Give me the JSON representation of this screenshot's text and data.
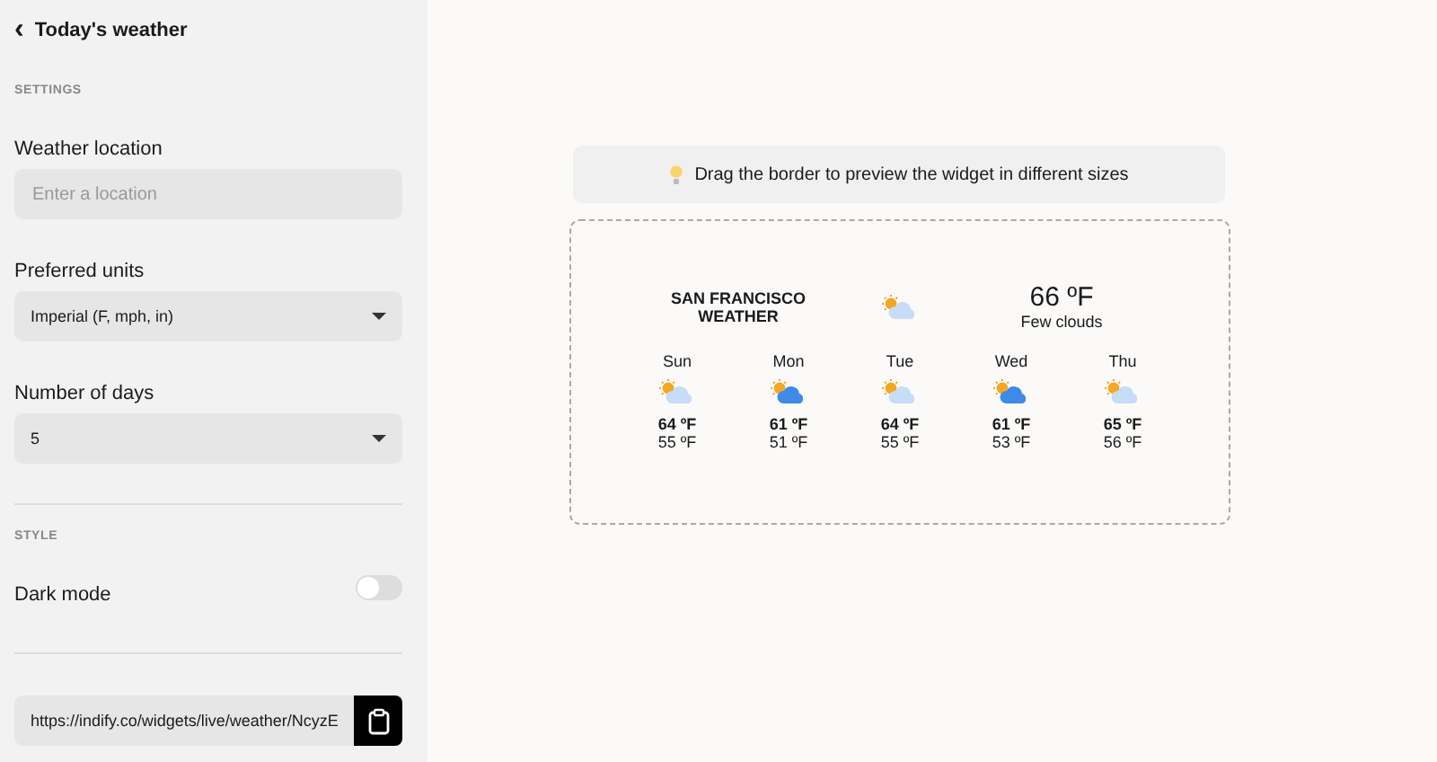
{
  "header": {
    "back_icon": "‹",
    "title": "Today's weather"
  },
  "settings": {
    "heading": "SETTINGS",
    "location": {
      "label": "Weather location",
      "placeholder": "Enter a location"
    },
    "units": {
      "label": "Preferred units",
      "value": "Imperial (F, mph, in)"
    },
    "days": {
      "label": "Number of days",
      "value": "5"
    }
  },
  "style": {
    "heading": "STYLE",
    "dark_mode": {
      "label": "Dark mode",
      "on": false
    }
  },
  "share": {
    "url": "https://indify.co/widgets/live/weather/NcyzE"
  },
  "hint": "Drag the border to preview the widget in different sizes",
  "widget": {
    "city": "SAN FRANCISCO",
    "subtitle": "WEATHER",
    "kind": "few_clouds",
    "temp": "66 ºF",
    "condition": "Few clouds",
    "days": [
      {
        "name": "Sun",
        "kind": "few_clouds",
        "high": "64 ºF",
        "low": "55 ºF"
      },
      {
        "name": "Mon",
        "kind": "broken_clouds",
        "high": "61 ºF",
        "low": "51 ºF"
      },
      {
        "name": "Tue",
        "kind": "few_clouds",
        "high": "64 ºF",
        "low": "55 ºF"
      },
      {
        "name": "Wed",
        "kind": "broken_clouds",
        "high": "61 ºF",
        "low": "53 ºF"
      },
      {
        "name": "Thu",
        "kind": "few_clouds",
        "high": "65 ºF",
        "low": "56 ºF"
      }
    ]
  }
}
